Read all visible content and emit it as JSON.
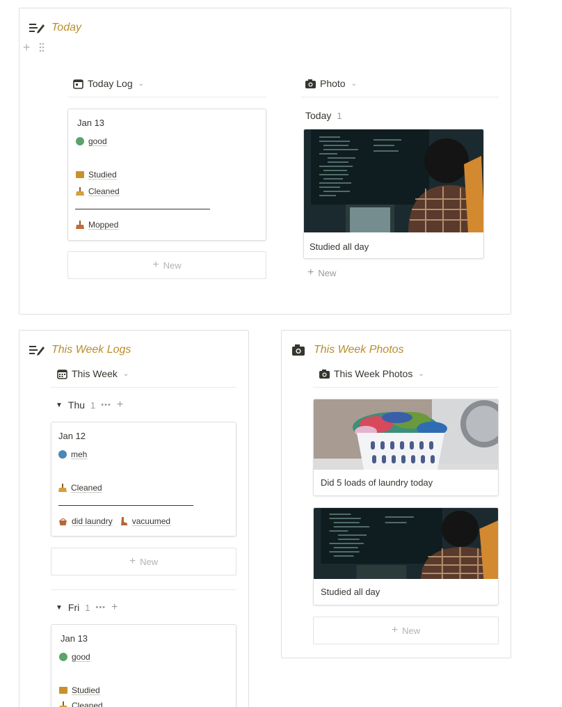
{
  "today": {
    "title": "Today",
    "log_view": {
      "label": "Today Log"
    },
    "photo_view": {
      "label": "Photo"
    },
    "log_card": {
      "date": "Jan 13",
      "mood": "good",
      "items": [
        "Studied",
        "Cleaned"
      ],
      "after_sep": "Mopped"
    },
    "new_label": "New",
    "photo_group": {
      "label": "Today",
      "count": "1"
    },
    "photo_card": {
      "caption": "Studied all day"
    },
    "photo_new_label": "New"
  },
  "week_logs": {
    "title": "This Week Logs",
    "view": {
      "label": "This Week"
    },
    "groups": [
      {
        "label": "Thu",
        "count": "1",
        "card": {
          "date": "Jan 12",
          "mood": "meh",
          "items": [
            "Cleaned"
          ],
          "after_sep": [
            "did laundry",
            "vacuumed"
          ]
        },
        "new_label": "New"
      },
      {
        "label": "Fri",
        "count": "1",
        "card": {
          "date": "Jan 13",
          "mood": "good",
          "items": [
            "Studied",
            "Cleaned"
          ]
        }
      }
    ]
  },
  "week_photos": {
    "title": "This Week Photos",
    "view": {
      "label": "This Week Photos"
    },
    "cards": [
      {
        "caption": "Did 5 loads of laundry today"
      },
      {
        "caption": "Studied all day"
      }
    ],
    "new_label": "New"
  },
  "colors": {
    "accent": "#b98d2a",
    "text": "#37352f",
    "muted": "#9b9a97",
    "border": "#dfdfde"
  },
  "icons": [
    "edit-list-icon",
    "calendar-icon",
    "camera-icon",
    "smile-icon",
    "book-icon",
    "broom-icon",
    "basket-icon",
    "boot-icon"
  ]
}
